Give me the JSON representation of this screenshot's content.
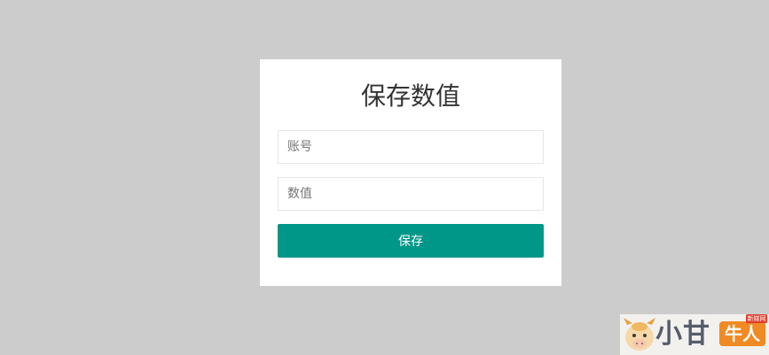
{
  "form": {
    "title": "保存数值",
    "account_placeholder": "账号",
    "value_placeholder": "数值",
    "save_label": "保存"
  },
  "colors": {
    "page_background": "#cccccc",
    "card_background": "#ffffff",
    "button": "#009688"
  },
  "watermark": {
    "brand_text": "小甘",
    "badge_text": "牛人",
    "small_tag": "新媒网",
    "logo_icon": "cow-mascot-icon"
  }
}
